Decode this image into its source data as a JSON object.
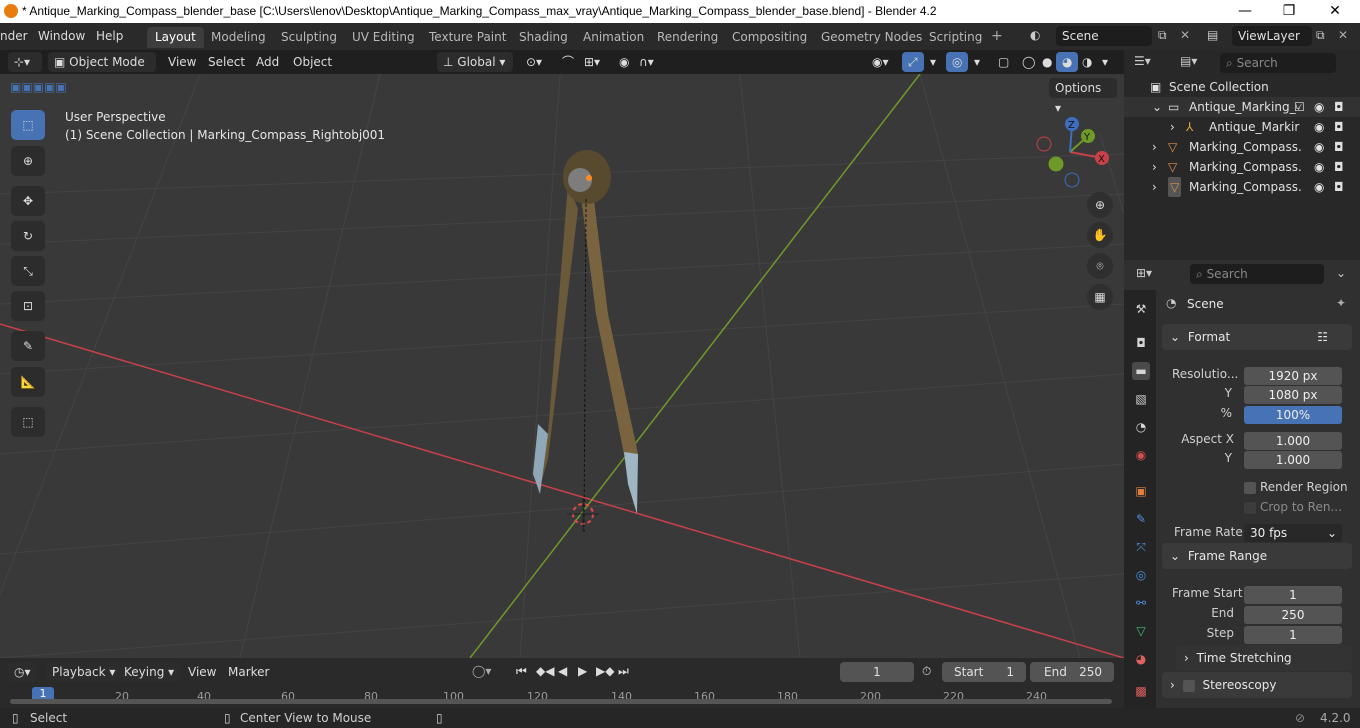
{
  "window": {
    "title": "* Antique_Marking_Compass_blender_base [C:\\Users\\lenov\\Desktop\\Antique_Marking_Compass_max_vray\\Antique_Marking_Compass_blender_base.blend] - Blender 4.2",
    "min": "—",
    "max": "❐",
    "close": "✕"
  },
  "menus": [
    "nder",
    "Window",
    "Help"
  ],
  "workspaces": [
    "Layout",
    "Modeling",
    "Sculpting",
    "UV Editing",
    "Texture Paint",
    "Shading",
    "Animation",
    "Rendering",
    "Compositing",
    "Geometry Nodes",
    "Scripting"
  ],
  "scene": {
    "name": "Scene"
  },
  "viewlayer": {
    "name": "ViewLayer"
  },
  "viewport": {
    "mode": "Object Mode",
    "menus": [
      "View",
      "Select",
      "Add",
      "Object"
    ],
    "orientation": "Global",
    "options": "Options",
    "perspective": "User Perspective",
    "context": "(1) Scene Collection | Marking_Compass_Rightobj001",
    "gizmo": {
      "x": "X",
      "y": "Y",
      "z": "Z"
    }
  },
  "outliner": {
    "search_placeholder": "Search",
    "root": "Scene Collection",
    "items": [
      {
        "label": "Antique_Marking_C",
        "type": "collection"
      },
      {
        "label": "Antique_Markir",
        "type": "armature"
      },
      {
        "label": "Marking_Compass.",
        "type": "mesh"
      },
      {
        "label": "Marking_Compass.",
        "type": "mesh"
      },
      {
        "label": "Marking_Compass.",
        "type": "mesh"
      }
    ]
  },
  "properties": {
    "search_placeholder": "Search",
    "context": "Scene",
    "format": {
      "header": "Format",
      "res_label": "Resolutio...",
      "res_x": "1920 px",
      "y_label": "Y",
      "res_y": "1080 px",
      "pct_label": "%",
      "pct": "100%",
      "aspect_label": "Aspect X",
      "aspect_x": "1.000",
      "aspect_y_label": "Y",
      "aspect_y": "1.000",
      "render_region": "Render Region",
      "crop": "Crop to Ren...",
      "framerate_label": "Frame Rate",
      "framerate": "30 fps"
    },
    "frame_range": {
      "header": "Frame Range",
      "start_label": "Frame Start",
      "start": "1",
      "end_label": "End",
      "end": "250",
      "step_label": "Step",
      "step": "1"
    },
    "time_stretching": "Time Stretching",
    "stereoscopy": "Stereoscopy"
  },
  "timeline": {
    "menus": [
      "Playback",
      "Keying",
      "View",
      "Marker"
    ],
    "current": "1",
    "start_label": "Start",
    "start": "1",
    "end_label": "End",
    "end": "250",
    "ticks": [
      "1",
      "20",
      "40",
      "60",
      "80",
      "100",
      "120",
      "140",
      "160",
      "180",
      "200",
      "220",
      "240"
    ]
  },
  "status": {
    "select": "Select",
    "center": "Center View to Mouse",
    "version": "4.2.0"
  },
  "colors": {
    "accent": "#4772b3",
    "x_axis": "#c8404a",
    "y_axis": "#6f9a28",
    "z_axis": "#3d6fbe"
  }
}
